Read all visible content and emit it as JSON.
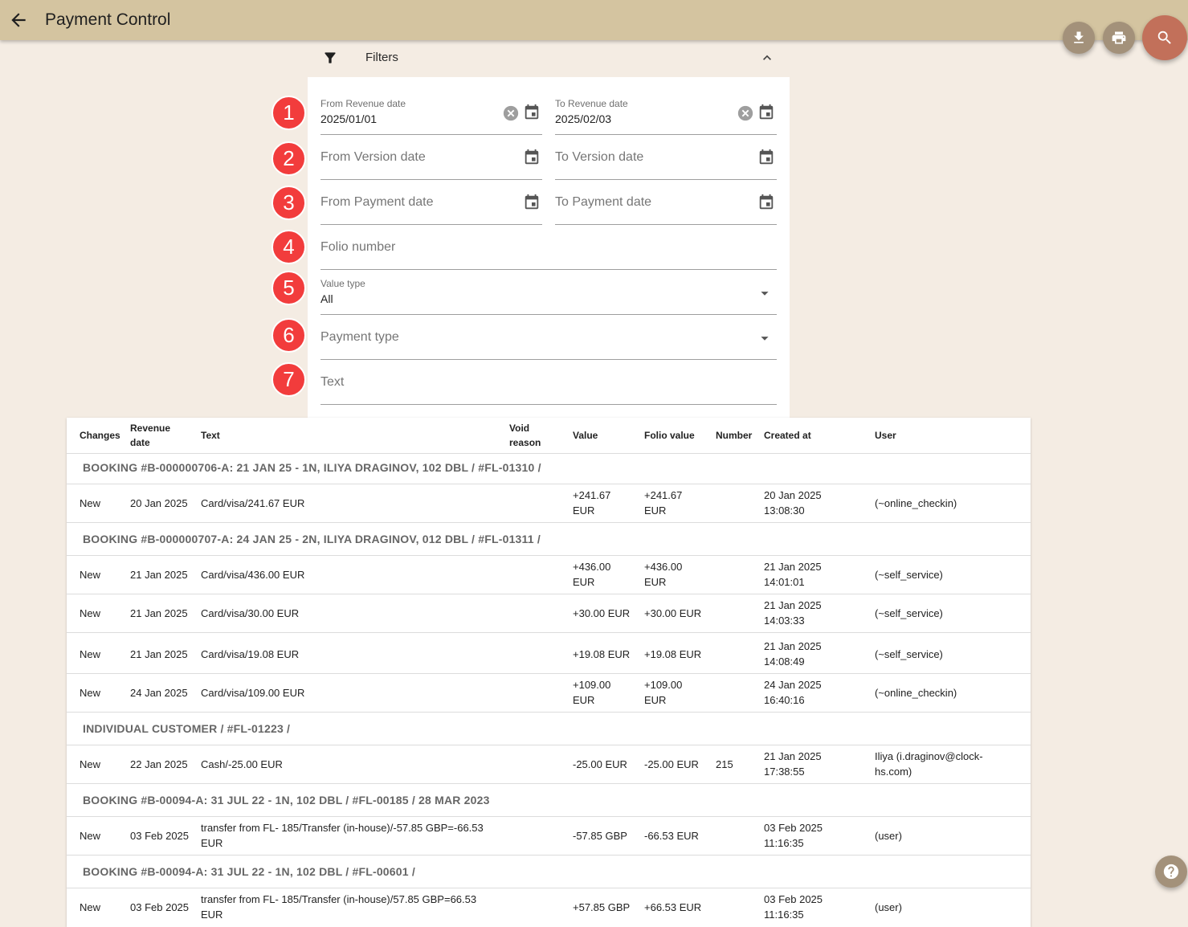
{
  "header": {
    "title": "Payment Control"
  },
  "filters": {
    "label": "Filters",
    "from_revenue": {
      "label": "From Revenue date",
      "value": "2025/01/01"
    },
    "to_revenue": {
      "label": "To Revenue date",
      "value": "2025/02/03"
    },
    "from_version": "From Version date",
    "to_version": "To Version date",
    "from_payment": "From Payment date",
    "to_payment": "To Payment date",
    "folio_number": "Folio number",
    "value_type": {
      "label": "Value type",
      "value": "All"
    },
    "payment_type": "Payment type",
    "text": "Text",
    "badges": [
      "1",
      "2",
      "3",
      "4",
      "5",
      "6",
      "7"
    ]
  },
  "table": {
    "columns": [
      "Changes",
      "Revenue date",
      "Text",
      "Void reason",
      "Value",
      "Folio value",
      "Number",
      "Created at",
      "User"
    ],
    "groups": [
      {
        "title": "BOOKING #B-000000706-A: 21 JAN 25 - 1N, ILIYA DRAGINOV, 102 DBL / #FL-01310 /",
        "rows": [
          {
            "changes": "New",
            "revenue_date": "20 Jan 2025",
            "text": "Card/visa/241.67 EUR",
            "void_reason": "",
            "value": "+241.67 EUR",
            "folio_value": "+241.67 EUR",
            "number": "",
            "created_at": "20 Jan 2025 13:08:30",
            "user": "(~online_checkin)"
          }
        ]
      },
      {
        "title": "BOOKING #B-000000707-A: 24 JAN 25 - 2N, ILIYA DRAGINOV, 012 DBL / #FL-01311 /",
        "rows": [
          {
            "changes": "New",
            "revenue_date": "21 Jan 2025",
            "text": "Card/visa/436.00 EUR",
            "void_reason": "",
            "value": "+436.00 EUR",
            "folio_value": "+436.00 EUR",
            "number": "",
            "created_at": "21 Jan 2025 14:01:01",
            "user": "(~self_service)"
          },
          {
            "changes": "New",
            "revenue_date": "21 Jan 2025",
            "text": "Card/visa/30.00 EUR",
            "void_reason": "",
            "value": "+30.00 EUR",
            "folio_value": "+30.00 EUR",
            "number": "",
            "created_at": "21 Jan 2025 14:03:33",
            "user": "(~self_service)"
          },
          {
            "changes": "New",
            "revenue_date": "21 Jan 2025",
            "text": "Card/visa/19.08 EUR",
            "void_reason": "",
            "value": "+19.08 EUR",
            "folio_value": "+19.08 EUR",
            "number": "",
            "created_at": "21 Jan 2025 14:08:49",
            "user": "(~self_service)"
          },
          {
            "changes": "New",
            "revenue_date": "24 Jan 2025",
            "text": "Card/visa/109.00 EUR",
            "void_reason": "",
            "value": "+109.00 EUR",
            "folio_value": "+109.00 EUR",
            "number": "",
            "created_at": "24 Jan 2025 16:40:16",
            "user": "(~online_checkin)"
          }
        ]
      },
      {
        "title": "INDIVIDUAL CUSTOMER / #FL-01223 /",
        "rows": [
          {
            "changes": "New",
            "revenue_date": "22 Jan 2025",
            "text": "Cash/-25.00 EUR",
            "void_reason": "",
            "value": "-25.00 EUR",
            "folio_value": "-25.00 EUR",
            "number": "215",
            "created_at": "21 Jan 2025 17:38:55",
            "user": "Iliya (i.draginov@clock-hs.com)"
          }
        ]
      },
      {
        "title": "BOOKING #B-00094-A: 31 JUL 22 - 1N, 102 DBL / #FL-00185 / 28 MAR 2023",
        "rows": [
          {
            "changes": "New",
            "revenue_date": "03 Feb 2025",
            "text": "transfer from FL- 185/Transfer (in-house)/-57.85 GBP=-66.53 EUR",
            "void_reason": "",
            "value": "-57.85 GBP",
            "folio_value": "-66.53 EUR",
            "number": "",
            "created_at": "03 Feb 2025 11:16:35",
            "user": "(user)"
          }
        ]
      },
      {
        "title": "BOOKING #B-00094-A: 31 JUL 22 - 1N, 102 DBL / #FL-00601 /",
        "rows": [
          {
            "changes": "New",
            "revenue_date": "03 Feb 2025",
            "text": "transfer from FL- 185/Transfer (in-house)/57.85 GBP=66.53 EUR",
            "void_reason": "",
            "value": "+57.85 GBP",
            "folio_value": "+66.53 EUR",
            "number": "",
            "created_at": "03 Feb 2025 11:16:35",
            "user": "(user)"
          }
        ]
      }
    ]
  },
  "colors": {
    "appbar": "#d4c4a0",
    "background": "#f4ece3",
    "fab": "#a3917a",
    "search_fab": "#c2705a",
    "badge": "#f23c3c"
  }
}
